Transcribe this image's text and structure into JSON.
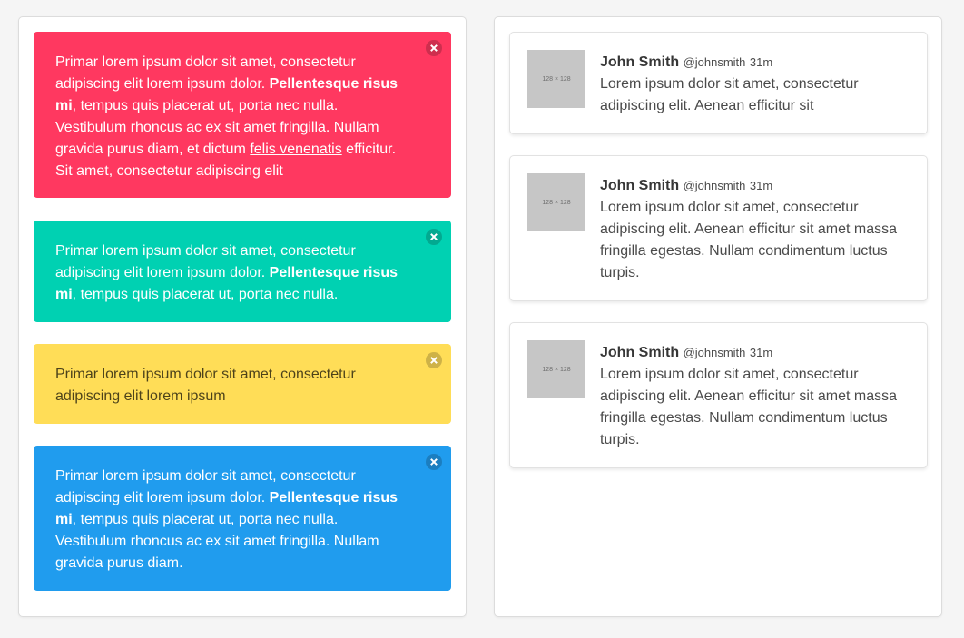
{
  "notifications": [
    {
      "parts": [
        {
          "text": "Primar lorem ipsum dolor sit amet, consectetur adipiscing elit lorem ipsum dolor. "
        },
        {
          "text": "Pellentesque risus mi",
          "style": "bold"
        },
        {
          "text": ", tempus quis placerat ut, porta nec nulla. Vestibulum rhoncus ac ex sit amet fringilla. Nullam gravida purus diam, et dictum "
        },
        {
          "text": "felis venenatis",
          "style": "underline"
        },
        {
          "text": " efficitur. Sit amet, consectetur adipiscing elit"
        }
      ]
    },
    {
      "parts": [
        {
          "text": "Primar lorem ipsum dolor sit amet, consectetur adipiscing elit lorem ipsum dolor. "
        },
        {
          "text": "Pellentesque risus mi",
          "style": "bold"
        },
        {
          "text": ", tempus quis placerat ut, porta nec nulla."
        }
      ]
    },
    {
      "parts": [
        {
          "text": "Primar lorem ipsum dolor sit amet, consectetur adipiscing elit lorem ipsum"
        }
      ]
    },
    {
      "parts": [
        {
          "text": "Primar lorem ipsum dolor sit amet, consectetur adipiscing elit lorem ipsum dolor. "
        },
        {
          "text": "Pellentesque risus mi",
          "style": "bold"
        },
        {
          "text": ", tempus quis placerat ut, porta nec nulla. Vestibulum rhoncus ac ex sit amet fringilla. Nullam gravida purus diam."
        }
      ]
    }
  ],
  "colors": {
    "danger": "#ff3860",
    "success": "#00d1b2",
    "warning": "#ffdd57",
    "info": "#209cee"
  },
  "media": [
    {
      "thumb": "128 × 128",
      "name": "John Smith",
      "handle": "@johnsmith",
      "time": "31m",
      "text": "Lorem ipsum dolor sit amet, consectetur adipiscing elit. Aenean efficitur sit"
    },
    {
      "thumb": "128 × 128",
      "name": "John Smith",
      "handle": "@johnsmith",
      "time": "31m",
      "text": "Lorem ipsum dolor sit amet, consectetur adipiscing elit. Aenean efficitur sit amet massa fringilla egestas. Nullam condimentum luctus turpis."
    },
    {
      "thumb": "128 × 128",
      "name": "John Smith",
      "handle": "@johnsmith",
      "time": "31m",
      "text": "Lorem ipsum dolor sit amet, consectetur adipiscing elit. Aenean efficitur sit amet massa fringilla egestas. Nullam condimentum luctus turpis."
    }
  ]
}
